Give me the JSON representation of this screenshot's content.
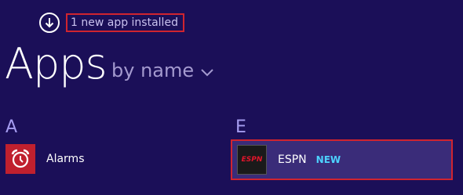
{
  "notification": {
    "icon": "download-arrow-icon",
    "text": "1 new app installed"
  },
  "header": {
    "title": "Apps",
    "sort_label": "by name"
  },
  "groups": [
    {
      "letter": "A",
      "apps": [
        {
          "name": "Alarms",
          "icon": "alarm-clock-icon",
          "icon_bg": "#c0202e"
        }
      ]
    },
    {
      "letter": "E",
      "apps": [
        {
          "name": "ESPN",
          "icon": "espn-icon",
          "logo_text": "ESPN",
          "badge": "NEW",
          "highlight": "#d0242f"
        }
      ]
    }
  ],
  "colors": {
    "background": "#1b0f58",
    "highlight_border": "#d0242f",
    "new_badge": "#4dd2ff",
    "group_letter": "#a59cf0"
  }
}
